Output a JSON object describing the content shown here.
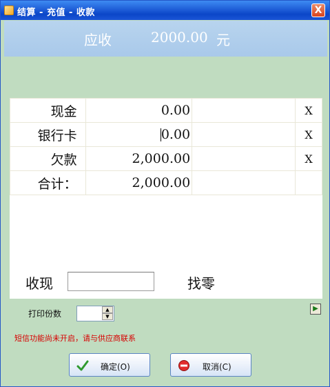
{
  "window": {
    "title": "结算 - 充值 - 收款",
    "close_glyph": "X"
  },
  "header": {
    "label": "应收",
    "amount": "2000.00",
    "unit": "元"
  },
  "payments": {
    "rows": [
      {
        "name": "现金",
        "amount": "0.00",
        "action": "X"
      },
      {
        "name": "银行卡",
        "amount": "0.00",
        "action": "X"
      },
      {
        "name": "欠款",
        "amount": "2,000.00",
        "action": "X"
      },
      {
        "name": "合计：",
        "amount": "2,000.00",
        "action": ""
      }
    ],
    "receive_label": "收现",
    "receive_value": "",
    "change_label": "找零"
  },
  "print": {
    "copies_label": "打印份数",
    "copies_value": ""
  },
  "notice": {
    "sms": "短信功能尚未开启，请与供应商联系"
  },
  "buttons": {
    "ok": "确定(O)",
    "cancel": "取消(C)"
  },
  "colors": {
    "body_bg": "#c0dcc0",
    "header_bg": "#afcdee",
    "notice": "#d80000",
    "titlebar": "#0b46c8"
  },
  "icons": {
    "window": "app-icon",
    "side": "export-arrow-icon",
    "ok": "checkmark-icon",
    "cancel": "no-entry-icon"
  }
}
